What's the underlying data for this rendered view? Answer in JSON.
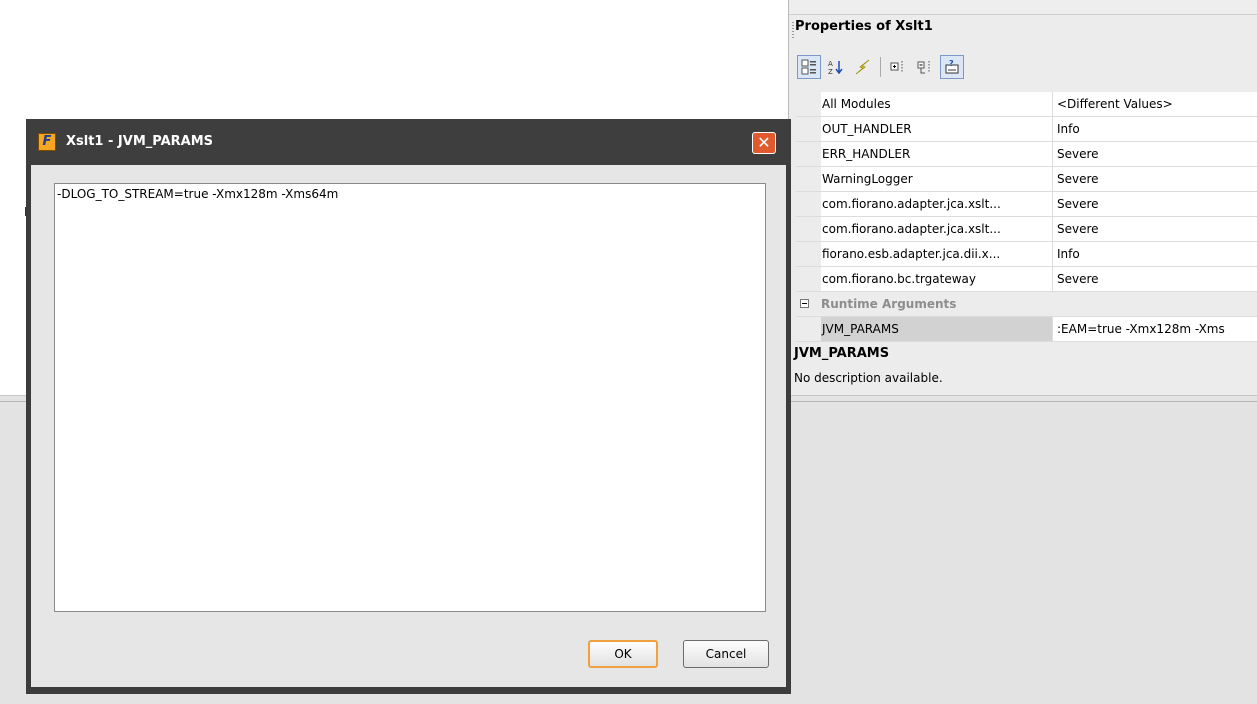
{
  "background": {
    "stray_letter": "F"
  },
  "properties_panel": {
    "title": "Properties of Xslt1",
    "toolbar": [
      {
        "icon": "categorized-view-icon",
        "pressed": true
      },
      {
        "icon": "sort-alphabetical-icon"
      },
      {
        "icon": "lightning-icon"
      },
      {
        "icon": "expand-all-icon"
      },
      {
        "icon": "collapse-all-icon"
      },
      {
        "icon": "show-description-icon",
        "pressed": true
      }
    ],
    "rows": [
      {
        "name": "All Modules",
        "value": "<Different Values>"
      },
      {
        "name": "OUT_HANDLER",
        "value": "Info"
      },
      {
        "name": "ERR_HANDLER",
        "value": "Severe"
      },
      {
        "name": "WarningLogger",
        "value": "Severe"
      },
      {
        "name": "com.fiorano.adapter.jca.xslt...",
        "value": "Severe"
      },
      {
        "name": "com.fiorano.adapter.jca.xslt...",
        "value": "Severe"
      },
      {
        "name": "fiorano.esb.adapter.jca.dii.x...",
        "value": "Info"
      },
      {
        "name": "com.fiorano.bc.trgateway",
        "value": "Severe"
      }
    ],
    "group": {
      "label": "Runtime Arguments"
    },
    "selected_row": {
      "name": "JVM_PARAMS",
      "value": ":EAM=true -Xmx128m -Xms"
    },
    "description": {
      "title": "JVM_PARAMS",
      "text": "No description available."
    }
  },
  "dialog": {
    "title": "Xslt1 - JVM_PARAMS",
    "icon_letter": "F",
    "text_value": "-DLOG_TO_STREAM=true -Xmx128m -Xms64m",
    "ok_label": "OK",
    "cancel_label": "Cancel",
    "close_glyph": "✕"
  },
  "colors": {
    "dialog_frame": "#3c3c3c",
    "close_button": "#e05a2e",
    "ok_focus_border": "#f0a040"
  }
}
